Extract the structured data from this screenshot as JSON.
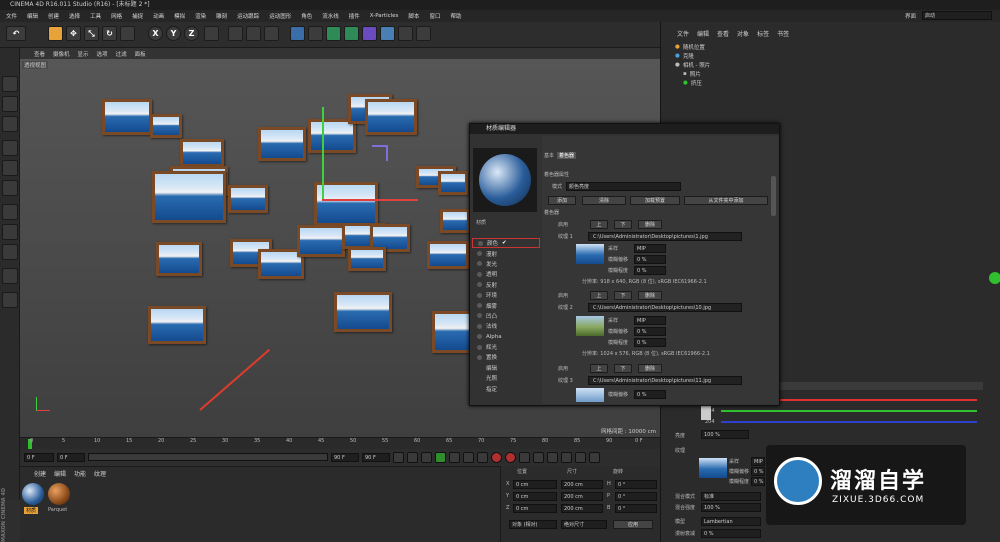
{
  "app": {
    "title": "CINEMA 4D R16.011 Studio (R16) - [未标题 2 *]"
  },
  "menubar": [
    "文件",
    "编辑",
    "创建",
    "选择",
    "工具",
    "网格",
    "捕捉",
    "动画",
    "模拟",
    "渲染",
    "雕刻",
    "运动跟踪",
    "运动图形",
    "角色",
    "流水线",
    "插件",
    "X-Particles",
    "脚本",
    "窗口",
    "帮助"
  ],
  "layout": {
    "label": "界面",
    "value": "启动"
  },
  "toolbar": {
    "undo": "↶",
    "move": "✥",
    "scale": "⤡",
    "rotate": "↻",
    "x": "X",
    "y": "Y",
    "z": "Z"
  },
  "viewport": {
    "menu": [
      "查看",
      "摄像机",
      "显示",
      "选项",
      "过滤",
      "面板"
    ],
    "label": "透视视图",
    "grid": "网格间距 : 10000 cm"
  },
  "timeline": {
    "ticks": [
      "0",
      "5",
      "10",
      "15",
      "20",
      "25",
      "30",
      "35",
      "40",
      "45",
      "50",
      "55",
      "60",
      "65",
      "70",
      "75",
      "80",
      "85",
      "90"
    ],
    "end_label": "0 F"
  },
  "transport": {
    "start": "0 F",
    "current": "0 F",
    "end": "90 F",
    "end2": "90 F"
  },
  "material_manager": {
    "menu": [
      "创建",
      "编辑",
      "功能",
      "纹理"
    ],
    "materials": [
      {
        "name": "材质"
      },
      {
        "name": "Parquet"
      }
    ]
  },
  "brand": {
    "vertical": "MAXON CINEMA 4D"
  },
  "coords": {
    "headers": [
      "位置",
      "尺寸",
      "旋转"
    ],
    "rows": [
      {
        "axis": "X",
        "pos": "0 cm",
        "size": "200 cm",
        "rot_axis": "H",
        "rot": "0 °"
      },
      {
        "axis": "Y",
        "pos": "0 cm",
        "size": "200 cm",
        "rot_axis": "P",
        "rot": "0 °"
      },
      {
        "axis": "Z",
        "pos": "0 cm",
        "size": "200 cm",
        "rot_axis": "B",
        "rot": "0 °"
      }
    ],
    "mode": "对象 (相对)",
    "size_mode": "绝对尺寸",
    "apply": "应用"
  },
  "object_manager": {
    "menu": [
      "文件",
      "编辑",
      "查看",
      "对象",
      "标签",
      "书签"
    ],
    "objects": [
      "随机位置",
      "克隆",
      "相机 - 照片",
      "照片",
      "挤压"
    ]
  },
  "attributes": {
    "rgb": [
      "204",
      "204",
      "204"
    ],
    "brightness_label": "亮度",
    "brightness": "100 %",
    "texture_label": "纹理",
    "sample_label": "采样",
    "sample": "MIP",
    "blur_offset_label": "模糊偏移",
    "blur_offset": "0 %",
    "blur_scale_label": "模糊程度",
    "blur_scale": "0 %",
    "mix_mode_label": "混合模式",
    "mix_mode": "标准",
    "mix_strength_label": "混合强度",
    "mix_strength": "100 %",
    "model_label": "模型",
    "model": "Lambertian",
    "diffuse_label": "漫射衰减",
    "diffuse": "0 %"
  },
  "dialog": {
    "title": "材质编辑器",
    "tabs": [
      "基本",
      "着色器"
    ],
    "shader_props": "着色器属性",
    "mode_label": "模式",
    "mode": "颜色亮度",
    "buttons": [
      "添加",
      "清除",
      "加载预置",
      "从文件夹中添加"
    ],
    "shader_section": "着色器",
    "mat_name": "材质",
    "channels": [
      "颜色",
      "漫射",
      "发光",
      "透明",
      "反射",
      "环境",
      "烟雾",
      "凹凸",
      "法线",
      "Alpha",
      "辉光",
      "置换",
      "编辑",
      "光照",
      "指定"
    ],
    "layers": [
      {
        "enable": "启用",
        "up": "上",
        "down": "下",
        "delete": "删除",
        "tex_label": "纹理 1",
        "path": "C:\\Users\\Administrator\\Desktop\\pictures\\1.jpg",
        "sample_label": "采样",
        "sample": "MIP",
        "blur_offset_label": "模糊偏移",
        "blur_offset": "0 %",
        "blur_scale_label": "模糊程度",
        "blur_scale": "0 %",
        "info": "分辨率: 918 x 640, RGB (8 位), sRGB IEC61966-2.1"
      },
      {
        "enable": "启用",
        "up": "上",
        "down": "下",
        "delete": "删除",
        "tex_label": "纹理 2",
        "path": "C:\\Users\\Administrator\\Desktop\\pictures\\10.jpg",
        "sample_label": "采样",
        "sample": "MIP",
        "blur_offset_label": "模糊偏移",
        "blur_offset": "0 %",
        "blur_scale_label": "模糊程度",
        "blur_scale": "0 %",
        "info": "分辨率: 1024 x 576, RGB (8 位), sRGB IEC61966-2.1"
      },
      {
        "enable": "启用",
        "up": "上",
        "down": "下",
        "delete": "删除",
        "tex_label": "纹理 3",
        "path": "C:\\Users\\Administrator\\Desktop\\pictures\\11.jpg",
        "blur_offset_label": "模糊偏移",
        "blur_offset": "0 %"
      }
    ]
  },
  "watermark": {
    "name": "溜溜自学",
    "url": "ZIXUE.3D66.COM"
  },
  "colors": {
    "accent": "#e8a23a",
    "frame": "#7a4a26",
    "arrow": "#e03b2b"
  }
}
